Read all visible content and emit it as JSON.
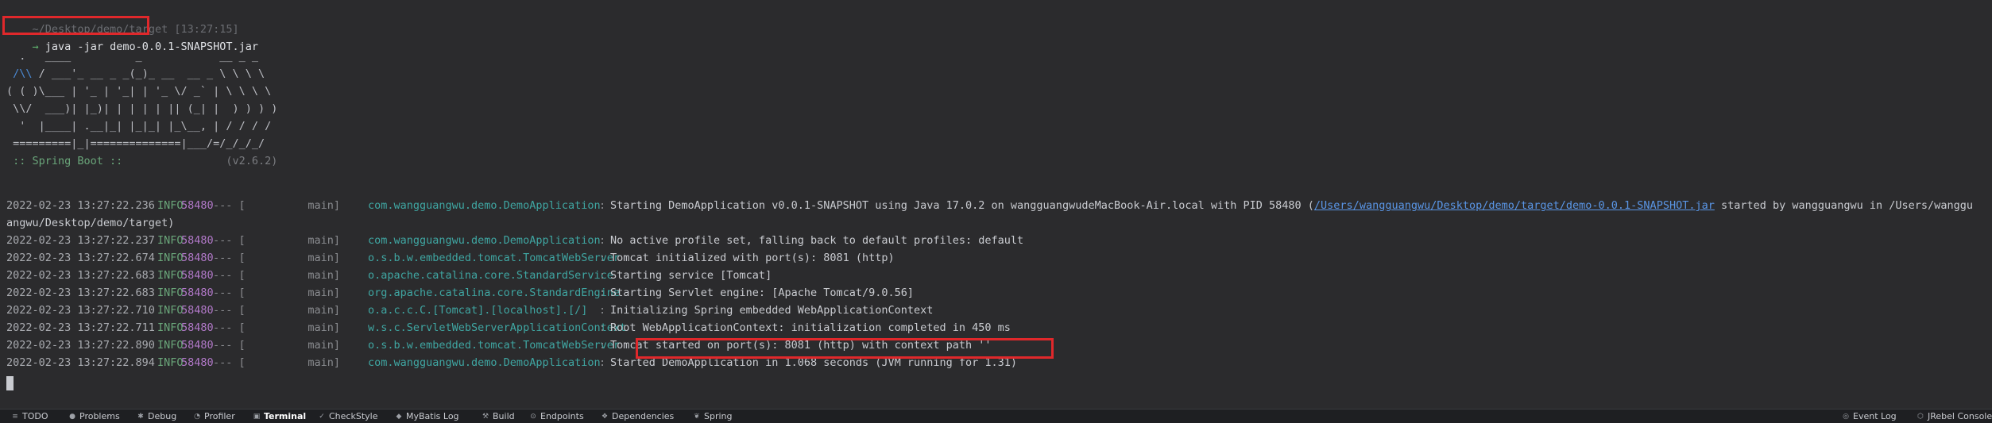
{
  "prompt": {
    "path": "~/Desktop/demo/target",
    "time": "[13:27:15]",
    "arrow": "→",
    "command": "java -jar demo-0.0.1-SNAPSHOT.jar"
  },
  "banner": {
    "l1": "  .   ____          _            __ _ _",
    "l2a": " ",
    "l2b": "/\\\\",
    "l2c": " / ___'_ __ _ _(_)_ __  __ _ \\ \\ \\ \\",
    "l3": "( ( )\\___ | '_ | '_| | '_ \\/ _` | \\ \\ \\ \\",
    "l4": " \\\\/  ___)| |_)| | | | | || (_| |  ) ) ) )",
    "l5": "  '  |____| .__|_| |_|_| |_\\__, | / / / /",
    "l6": " =========|_|==============|___/=/_/_/_/",
    "spring": " :: Spring Boot :: ",
    "version": "               (v2.6.2)"
  },
  "logs": [
    {
      "date": "2022-02-23 13:27:22.236",
      "level": "INFO",
      "pid": "58480",
      "sep": "--- [",
      "thread": "           main]",
      "logger": "com.wangguangwu.demo.DemoApplication",
      "msg_pre": "Starting DemoApplication v0.0.1-SNAPSHOT using Java 17.0.2 on wangguangwudeMacBook-Air.local with PID 58480 (",
      "link": "/Users/wangguangwu/Desktop/demo/target/demo-0.0.1-SNAPSHOT.jar",
      "msg_post": " started by wangguangwu in /Users/wanggu"
    },
    {
      "wrap": "angwu/Desktop/demo/target)"
    },
    {
      "date": "2022-02-23 13:27:22.237",
      "level": "INFO",
      "pid": "58480",
      "sep": "--- [",
      "thread": "           main]",
      "logger": "com.wangguangwu.demo.DemoApplication",
      "msg": "No active profile set, falling back to default profiles: default"
    },
    {
      "date": "2022-02-23 13:27:22.674",
      "level": "INFO",
      "pid": "58480",
      "sep": "--- [",
      "thread": "           main]",
      "logger": "o.s.b.w.embedded.tomcat.TomcatWebServer",
      "msg": "Tomcat initialized with port(s): 8081 (http)"
    },
    {
      "date": "2022-02-23 13:27:22.683",
      "level": "INFO",
      "pid": "58480",
      "sep": "--- [",
      "thread": "           main]",
      "logger": "o.apache.catalina.core.StandardService",
      "msg": "Starting service [Tomcat]"
    },
    {
      "date": "2022-02-23 13:27:22.683",
      "level": "INFO",
      "pid": "58480",
      "sep": "--- [",
      "thread": "           main]",
      "logger": "org.apache.catalina.core.StandardEngine",
      "msg": "Starting Servlet engine: [Apache Tomcat/9.0.56]"
    },
    {
      "date": "2022-02-23 13:27:22.710",
      "level": "INFO",
      "pid": "58480",
      "sep": "--- [",
      "thread": "           main]",
      "logger": "o.a.c.c.C.[Tomcat].[localhost].[/]",
      "msg": "Initializing Spring embedded WebApplicationContext"
    },
    {
      "date": "2022-02-23 13:27:22.711",
      "level": "INFO",
      "pid": "58480",
      "sep": "--- [",
      "thread": "           main]",
      "logger": "w.s.c.ServletWebServerApplicationContext",
      "msg": "Root WebApplicationContext: initialization completed in 450 ms"
    },
    {
      "date": "2022-02-23 13:27:22.890",
      "level": "INFO",
      "pid": "58480",
      "sep": "--- [",
      "thread": "           main]",
      "logger": "o.s.b.w.embedded.tomcat.TomcatWebServer",
      "msg": "Tomcat started on port(s): 8081 (http) with context path ''"
    },
    {
      "date": "2022-02-23 13:27:22.894",
      "level": "INFO",
      "pid": "58480",
      "sep": "--- [",
      "thread": "           main]",
      "logger": "com.wangguangwu.demo.DemoApplication",
      "msg": "Started DemoApplication in 1.068 seconds (JVM running for 1.31)"
    }
  ],
  "toolbar": {
    "todo": "TODO",
    "problems": "Problems",
    "debug": "Debug",
    "profiler": "Profiler",
    "terminal": "Terminal",
    "checkstyle": "CheckStyle",
    "mybatis": "MyBatis Log",
    "build": "Build",
    "endpoints": "Endpoints",
    "dependencies": "Dependencies",
    "spring": "Spring",
    "eventlog": "Event Log",
    "jrebel": "JRebel Console"
  },
  "colors": {
    "background": "#2b2b2d",
    "highlight": "#e0282b",
    "info": "#6aa67a",
    "pid": "#b279c9",
    "logger": "#3fa6a2"
  }
}
